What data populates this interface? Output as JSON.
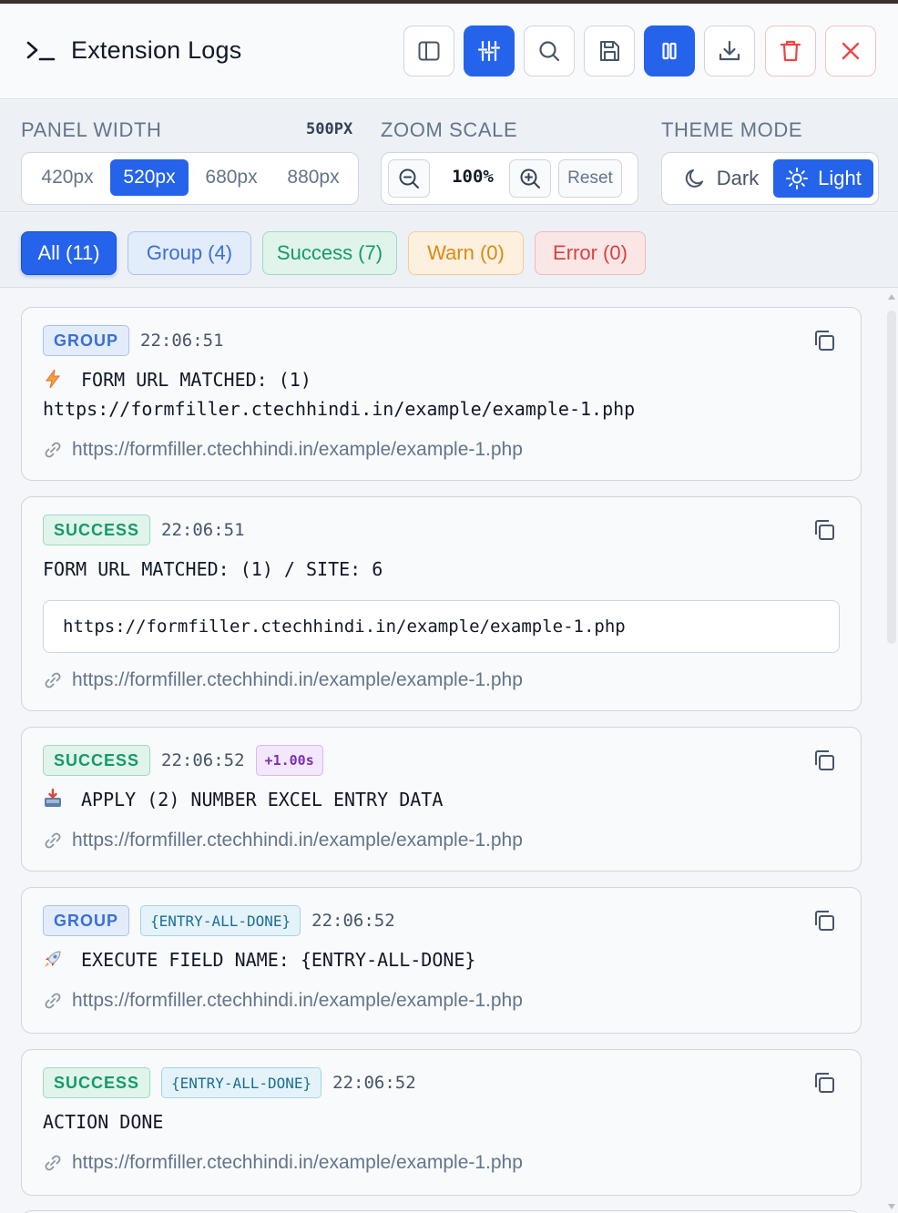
{
  "header": {
    "title": "Extension Logs",
    "toolbar": [
      {
        "name": "sidebar-toggle-button",
        "icon": "sidebar-icon",
        "active": false
      },
      {
        "name": "filters-toggle-button",
        "icon": "sliders-icon",
        "active": true
      },
      {
        "name": "search-button",
        "icon": "search-icon",
        "active": false
      },
      {
        "name": "save-button",
        "icon": "save-icon",
        "active": false
      },
      {
        "name": "pause-button",
        "icon": "pause-icon",
        "active": true
      },
      {
        "name": "download-button",
        "icon": "download-icon",
        "active": false
      },
      {
        "name": "clear-logs-button",
        "icon": "trash-icon",
        "active": false
      },
      {
        "name": "close-button",
        "icon": "close-icon",
        "active": false
      }
    ]
  },
  "controls": {
    "panel_width": {
      "label": "PANEL WIDTH",
      "value": "500PX",
      "options": [
        "420px",
        "520px",
        "680px",
        "880px"
      ],
      "selected": "520px"
    },
    "zoom": {
      "label": "ZOOM SCALE",
      "value": "100%",
      "reset_label": "Reset"
    },
    "theme": {
      "label": "THEME MODE",
      "dark_label": "Dark",
      "light_label": "Light",
      "selected": "Light"
    }
  },
  "filters": {
    "all": "All (11)",
    "group": "Group (4)",
    "success": "Success (7)",
    "warn": "Warn (0)",
    "error": "Error (0)"
  },
  "logs": [
    {
      "level": "GROUP",
      "time": "22:06:51",
      "emoji": "lightning-icon",
      "message_line1": "FORM URL MATCHED: (1)",
      "message_line2": "https://formfiller.ctechhindi.in/example/example-1.php",
      "url": "https://formfiller.ctechhindi.in/example/example-1.php"
    },
    {
      "level": "SUCCESS",
      "time": "22:06:51",
      "message": "FORM URL MATCHED: (1) / SITE: 6",
      "code": "https://formfiller.ctechhindi.in/example/example-1.php",
      "url": "https://formfiller.ctechhindi.in/example/example-1.php"
    },
    {
      "level": "SUCCESS",
      "time": "22:06:52",
      "delta": "+1.00s",
      "emoji": "inbox-tray-icon",
      "message": "APPLY (2) NUMBER EXCEL ENTRY DATA",
      "url": "https://formfiller.ctechhindi.in/example/example-1.php"
    },
    {
      "level": "GROUP",
      "tag": "{ENTRY-ALL-DONE}",
      "time": "22:06:52",
      "emoji": "rocket-icon",
      "message": "EXECUTE FIELD NAME: {ENTRY-ALL-DONE}",
      "url": "https://formfiller.ctechhindi.in/example/example-1.php"
    },
    {
      "level": "SUCCESS",
      "tag": "{ENTRY-ALL-DONE}",
      "time": "22:06:52",
      "message": "ACTION DONE",
      "url": "https://formfiller.ctechhindi.in/example/example-1.php"
    }
  ],
  "colors": {
    "accent": "#2563eb",
    "group": "#3b6fd6",
    "success": "#169a6a",
    "warn": "#d98a12",
    "error": "#dc4040"
  }
}
